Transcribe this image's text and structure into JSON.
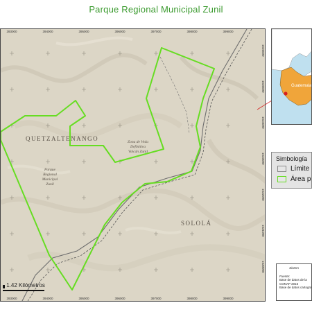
{
  "title": "Parque Regional Municipal Zunil",
  "map": {
    "x_ticks_top": [
      "393000",
      "394000",
      "395000",
      "396000",
      "397000",
      "398000",
      "399000"
    ],
    "x_ticks_bottom": [
      "393000",
      "394000",
      "395000",
      "396000",
      "397000",
      "398000",
      "399000"
    ],
    "y_ticks_right": [
      "1636000",
      "1635000",
      "1634000",
      "1633000",
      "1632000",
      "1631000",
      "1630000"
    ],
    "place_labels": {
      "quetzaltenango": "QUETZALTENANGO",
      "solola": "SOLOLÁ",
      "parque": [
        "Parque",
        "Regional",
        "Municipal",
        "Zunil"
      ],
      "zona_veda": [
        "Zona de Veda",
        "Definitiva",
        "Volcán Zunil"
      ]
    },
    "scale_label": "1.42 Kilómetros",
    "colors": {
      "park_boundary": "#66dd22",
      "terrain": "#dcd6c6",
      "municipal_limit": "#555555",
      "road": "#6e6e6e"
    }
  },
  "inset": {
    "label": "Guatemala",
    "colors": {
      "sea": "#bfe0ef",
      "country": "#f0a53a",
      "neighbors": "#ffffff",
      "marker": "#d62020"
    }
  },
  "legend": {
    "title": "Simbología",
    "items": [
      {
        "label": "Límite",
        "fill": "#e6e6e6",
        "border": "#888888"
      },
      {
        "label": "Área pr",
        "fill": "#e6e6e6",
        "border": "#66dd22"
      }
    ]
  },
  "info": {
    "lines": [
      "Sistem",
      "Fuente:",
      "Base de datos de la",
      "CONAP 2016",
      "Base de datos cartogra"
    ]
  }
}
